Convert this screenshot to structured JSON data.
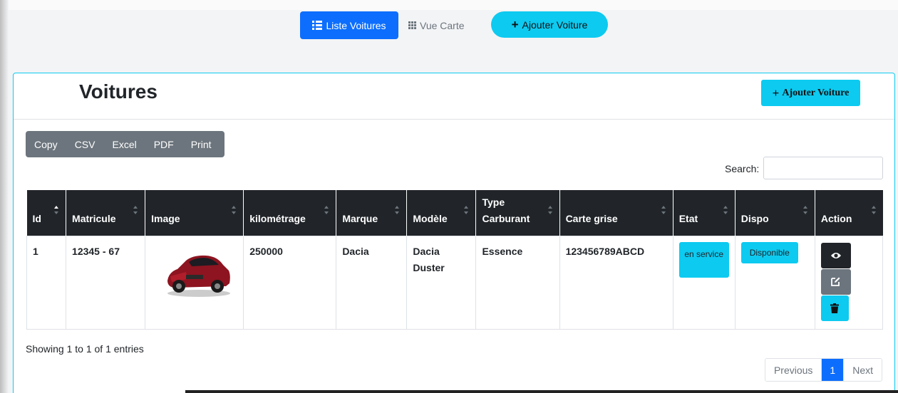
{
  "top_nav": {
    "list_label": "Liste Voitures",
    "card_label": "Vue Carte",
    "add_label": "Ajouter Voiture"
  },
  "card": {
    "title": "Voitures",
    "add_label": "Ajouter Voiture"
  },
  "export_buttons": [
    "Copy",
    "CSV",
    "Excel",
    "PDF",
    "Print"
  ],
  "search": {
    "label": "Search:",
    "value": "",
    "placeholder": ""
  },
  "table": {
    "headers": [
      "Id",
      "Matricule",
      "Image",
      "kilométrage",
      "Marque",
      "Modèle",
      "Type Carburant",
      "Carte grise",
      "Etat",
      "Dispo",
      "Action"
    ],
    "rows": [
      {
        "id": "1",
        "matricule": "12345 - 67",
        "image": "red-car-image",
        "kilometrage": "250000",
        "marque": "Dacia",
        "modele": "Dacia Duster",
        "carburant": "Essence",
        "carte_grise": "123456789ABCD",
        "etat": "en service",
        "dispo": "Disponible"
      }
    ]
  },
  "footer": {
    "info": "Showing 1 to 1 of 1 entries",
    "prev": "Previous",
    "page": "1",
    "next": "Next"
  },
  "colors": {
    "primary": "#0d6efd",
    "info": "#0dcaf0",
    "dark": "#212529",
    "secondary": "#6c757d"
  }
}
